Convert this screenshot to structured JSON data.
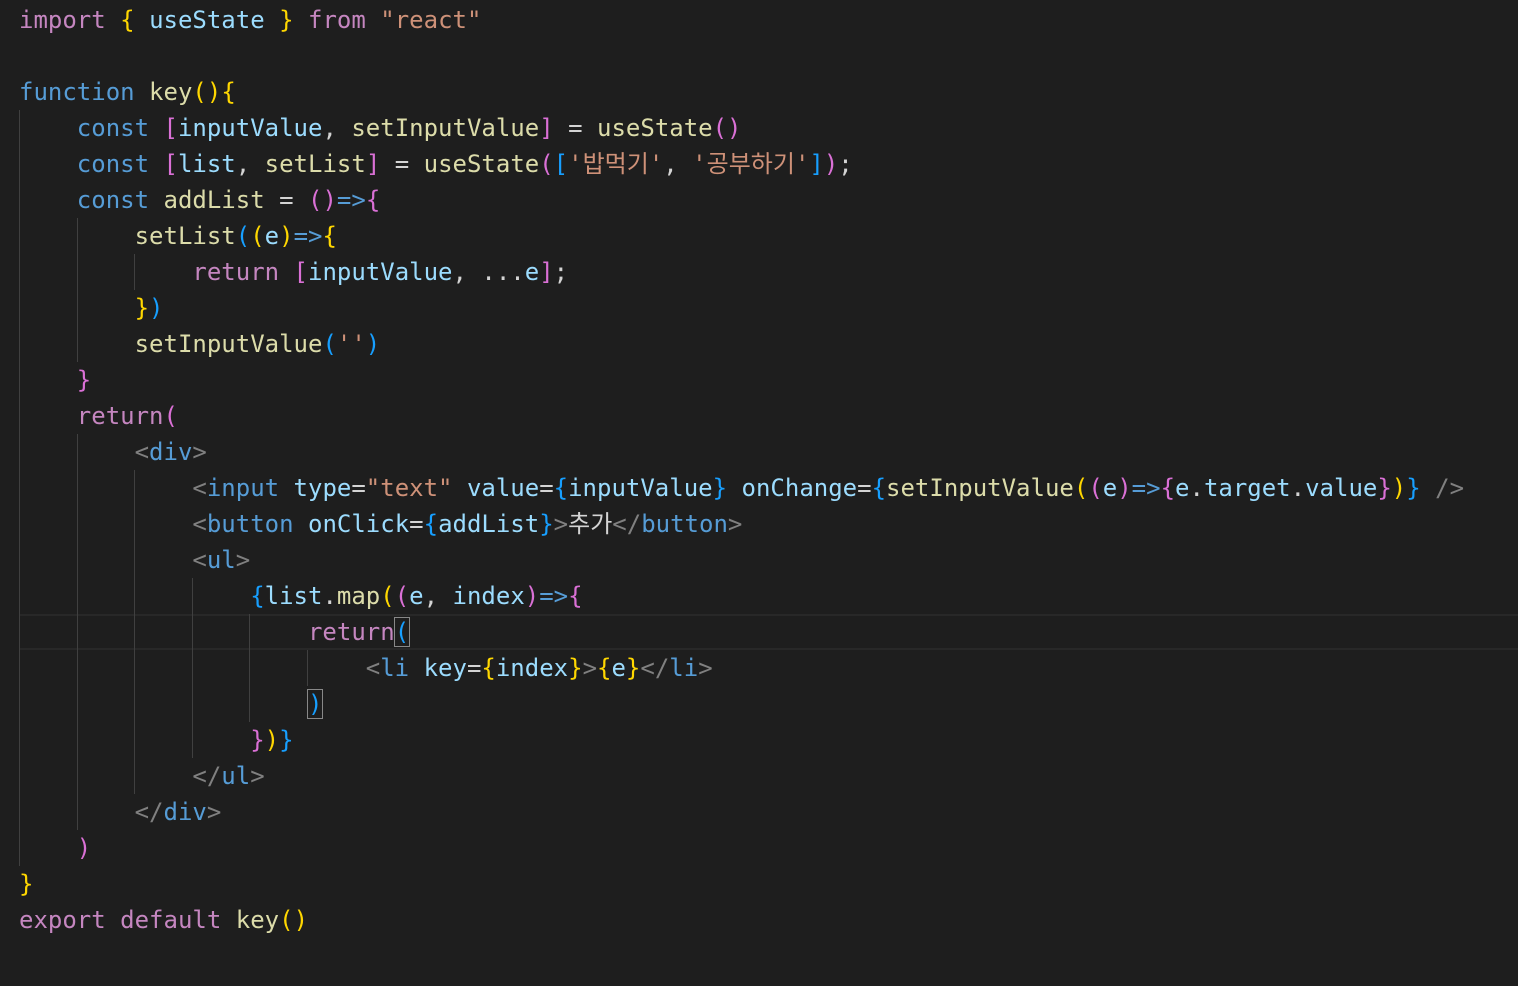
{
  "editor": {
    "language": "javascript-react",
    "theme_colors": {
      "background": "#1e1e1e",
      "keyword_control": "#c586c0",
      "keyword_storage": "#569cd6",
      "function": "#dcdcaa",
      "variable": "#9cdcfe",
      "string": "#ce9178",
      "bracket_level1": "#ffd700",
      "bracket_level2": "#da70d6",
      "bracket_level3": "#179fff",
      "tag_punctuation": "#808080"
    },
    "lines": [
      [
        [
          "kw-purple",
          "import"
        ],
        [
          "punc",
          " "
        ],
        [
          "b1",
          "{"
        ],
        [
          "punc",
          " "
        ],
        [
          "var",
          "useState"
        ],
        [
          "punc",
          " "
        ],
        [
          "b1",
          "}"
        ],
        [
          "punc",
          " "
        ],
        [
          "kw-purple",
          "from"
        ],
        [
          "punc",
          " "
        ],
        [
          "str",
          "\"react\""
        ]
      ],
      [],
      [
        [
          "kw-blue",
          "function"
        ],
        [
          "punc",
          " "
        ],
        [
          "fn",
          "key"
        ],
        [
          "b1",
          "()"
        ],
        [
          "b1",
          "{"
        ]
      ],
      [
        [
          "punc",
          "    "
        ],
        [
          "kw-blue",
          "const"
        ],
        [
          "punc",
          " "
        ],
        [
          "b2",
          "["
        ],
        [
          "var",
          "inputValue"
        ],
        [
          "punc",
          ", "
        ],
        [
          "fn",
          "setInputValue"
        ],
        [
          "b2",
          "]"
        ],
        [
          "punc",
          " = "
        ],
        [
          "fn",
          "useState"
        ],
        [
          "b2",
          "()"
        ]
      ],
      [
        [
          "punc",
          "    "
        ],
        [
          "kw-blue",
          "const"
        ],
        [
          "punc",
          " "
        ],
        [
          "b2",
          "["
        ],
        [
          "var",
          "list"
        ],
        [
          "punc",
          ", "
        ],
        [
          "fn",
          "setList"
        ],
        [
          "b2",
          "]"
        ],
        [
          "punc",
          " = "
        ],
        [
          "fn",
          "useState"
        ],
        [
          "b2",
          "("
        ],
        [
          "b3",
          "["
        ],
        [
          "str",
          "'밥먹기'"
        ],
        [
          "punc",
          ", "
        ],
        [
          "str",
          "'공부하기'"
        ],
        [
          "b3",
          "]"
        ],
        [
          "b2",
          ")"
        ],
        [
          "punc",
          ";"
        ]
      ],
      [
        [
          "punc",
          "    "
        ],
        [
          "kw-blue",
          "const"
        ],
        [
          "punc",
          " "
        ],
        [
          "fn",
          "addList"
        ],
        [
          "punc",
          " = "
        ],
        [
          "b2",
          "()"
        ],
        [
          "kw-blue",
          "=>"
        ],
        [
          "b2",
          "{"
        ]
      ],
      [
        [
          "punc",
          "        "
        ],
        [
          "fn",
          "setList"
        ],
        [
          "b3",
          "("
        ],
        [
          "b1",
          "("
        ],
        [
          "var",
          "e"
        ],
        [
          "b1",
          ")"
        ],
        [
          "kw-blue",
          "=>"
        ],
        [
          "b1",
          "{"
        ]
      ],
      [
        [
          "punc",
          "            "
        ],
        [
          "kw-purple",
          "return"
        ],
        [
          "punc",
          " "
        ],
        [
          "b2",
          "["
        ],
        [
          "var",
          "inputValue"
        ],
        [
          "punc",
          ", ..."
        ],
        [
          "var",
          "e"
        ],
        [
          "b2",
          "]"
        ],
        [
          "punc",
          ";"
        ]
      ],
      [
        [
          "punc",
          "        "
        ],
        [
          "b1",
          "}"
        ],
        [
          "b3",
          ")"
        ]
      ],
      [
        [
          "punc",
          "        "
        ],
        [
          "fn",
          "setInputValue"
        ],
        [
          "b3",
          "("
        ],
        [
          "str",
          "''"
        ],
        [
          "b3",
          ")"
        ]
      ],
      [
        [
          "punc",
          "    "
        ],
        [
          "b2",
          "}"
        ]
      ],
      [
        [
          "punc",
          "    "
        ],
        [
          "kw-purple",
          "return"
        ],
        [
          "b2",
          "("
        ]
      ],
      [
        [
          "punc",
          "        "
        ],
        [
          "tagp",
          "<"
        ],
        [
          "tag",
          "div"
        ],
        [
          "tagp",
          ">"
        ]
      ],
      [
        [
          "punc",
          "            "
        ],
        [
          "tagp",
          "<"
        ],
        [
          "tag",
          "input"
        ],
        [
          "punc",
          " "
        ],
        [
          "attr",
          "type"
        ],
        [
          "punc",
          "="
        ],
        [
          "str",
          "\"text\""
        ],
        [
          "punc",
          " "
        ],
        [
          "attr",
          "value"
        ],
        [
          "punc",
          "="
        ],
        [
          "b3",
          "{"
        ],
        [
          "var",
          "inputValue"
        ],
        [
          "b3",
          "}"
        ],
        [
          "punc",
          " "
        ],
        [
          "attr",
          "onChange"
        ],
        [
          "punc",
          "="
        ],
        [
          "b3",
          "{"
        ],
        [
          "fn",
          "setInputValue"
        ],
        [
          "b1",
          "("
        ],
        [
          "b2",
          "("
        ],
        [
          "var",
          "e"
        ],
        [
          "b2",
          ")"
        ],
        [
          "kw-blue",
          "=>"
        ],
        [
          "b2",
          "{"
        ],
        [
          "var",
          "e"
        ],
        [
          "punc",
          "."
        ],
        [
          "var",
          "target"
        ],
        [
          "punc",
          "."
        ],
        [
          "var",
          "value"
        ],
        [
          "b2",
          "}"
        ],
        [
          "b1",
          ")"
        ],
        [
          "b3",
          "}"
        ],
        [
          "punc",
          " "
        ],
        [
          "tagp",
          "/>"
        ]
      ],
      [
        [
          "punc",
          "            "
        ],
        [
          "tagp",
          "<"
        ],
        [
          "tag",
          "button"
        ],
        [
          "punc",
          " "
        ],
        [
          "attr",
          "onClick"
        ],
        [
          "punc",
          "="
        ],
        [
          "b3",
          "{"
        ],
        [
          "var",
          "addList"
        ],
        [
          "b3",
          "}"
        ],
        [
          "tagp",
          ">"
        ],
        [
          "txt",
          "추가"
        ],
        [
          "tagp",
          "</"
        ],
        [
          "tag",
          "button"
        ],
        [
          "tagp",
          ">"
        ]
      ],
      [
        [
          "punc",
          "            "
        ],
        [
          "tagp",
          "<"
        ],
        [
          "tag",
          "ul"
        ],
        [
          "tagp",
          ">"
        ]
      ],
      [
        [
          "punc",
          "                "
        ],
        [
          "b3",
          "{"
        ],
        [
          "var",
          "list"
        ],
        [
          "punc",
          "."
        ],
        [
          "fn",
          "map"
        ],
        [
          "b1",
          "("
        ],
        [
          "b2",
          "("
        ],
        [
          "var",
          "e"
        ],
        [
          "punc",
          ", "
        ],
        [
          "var",
          "index"
        ],
        [
          "b2",
          ")"
        ],
        [
          "kw-blue",
          "=>"
        ],
        [
          "b2",
          "{"
        ]
      ],
      [
        [
          "punc",
          "                    "
        ],
        [
          "kw-purple",
          "return"
        ],
        [
          "b3",
          "("
        ]
      ],
      [
        [
          "punc",
          "                        "
        ],
        [
          "tagp",
          "<"
        ],
        [
          "tag",
          "li"
        ],
        [
          "punc",
          " "
        ],
        [
          "attr",
          "key"
        ],
        [
          "punc",
          "="
        ],
        [
          "b1",
          "{"
        ],
        [
          "var",
          "index"
        ],
        [
          "b1",
          "}"
        ],
        [
          "tagp",
          ">"
        ],
        [
          "b1",
          "{"
        ],
        [
          "var",
          "e"
        ],
        [
          "b1",
          "}"
        ],
        [
          "tagp",
          "</"
        ],
        [
          "tag",
          "li"
        ],
        [
          "tagp",
          ">"
        ]
      ],
      [
        [
          "punc",
          "                    "
        ],
        [
          "b3",
          ")"
        ]
      ],
      [
        [
          "punc",
          "                "
        ],
        [
          "b2",
          "}"
        ],
        [
          "b1",
          ")"
        ],
        [
          "b3",
          "}"
        ]
      ],
      [
        [
          "punc",
          "            "
        ],
        [
          "tagp",
          "</"
        ],
        [
          "tag",
          "ul"
        ],
        [
          "tagp",
          ">"
        ]
      ],
      [
        [
          "punc",
          "        "
        ],
        [
          "tagp",
          "</"
        ],
        [
          "tag",
          "div"
        ],
        [
          "tagp",
          ">"
        ]
      ],
      [
        [
          "punc",
          "    "
        ],
        [
          "b2",
          ")"
        ]
      ],
      [
        [
          "b1",
          "}"
        ]
      ],
      [
        [
          "kw-purple",
          "export"
        ],
        [
          "punc",
          " "
        ],
        [
          "kw-purple",
          "default"
        ],
        [
          "punc",
          " "
        ],
        [
          "fn",
          "key"
        ],
        [
          "b1",
          "()"
        ]
      ]
    ]
  }
}
